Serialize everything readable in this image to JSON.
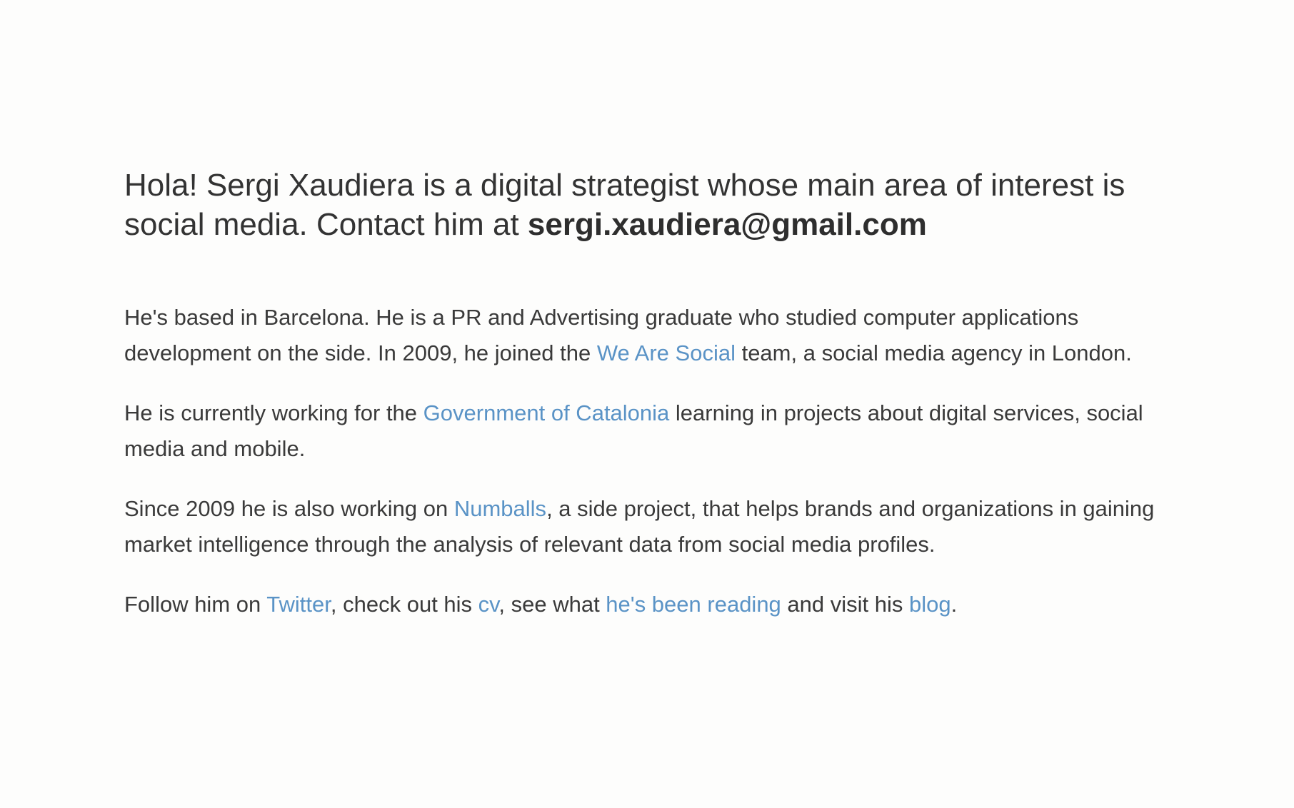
{
  "intro": {
    "greeting": "Hola! Sergi Xaudiera is a digital strategist whose main area of interest is social media. Contact him at ",
    "email": "sergi.xaudiera@gmail.com"
  },
  "paragraphs": {
    "p1": {
      "text_a": "He's based in Barcelona. He is a PR and Advertising graduate who studied computer applications development on the side. In 2009, he joined the ",
      "link_we_are_social": "We Are Social",
      "text_b": " team, a social media agency in London."
    },
    "p2": {
      "text_a": "He is currently working for the ",
      "link_government": "Government of Catalonia",
      "text_b": " learning in projects about digital services, social media and mobile."
    },
    "p3": {
      "text_a": "Since 2009 he is also working on ",
      "link_numballs": "Numballs",
      "text_b": ", a side project, that helps brands and organizations in gaining market intelligence through the analysis of relevant data from social media profiles."
    },
    "p4": {
      "text_a": "Follow him on ",
      "link_twitter": "Twitter",
      "text_b": ", check out his ",
      "link_cv": "cv",
      "text_c": ", see what ",
      "link_reading": "he's been reading",
      "text_d": " and visit his ",
      "link_blog": "blog",
      "text_e": "."
    }
  },
  "colors": {
    "background": "#fdfdfc",
    "text": "#333333",
    "link": "#5a93c6"
  }
}
